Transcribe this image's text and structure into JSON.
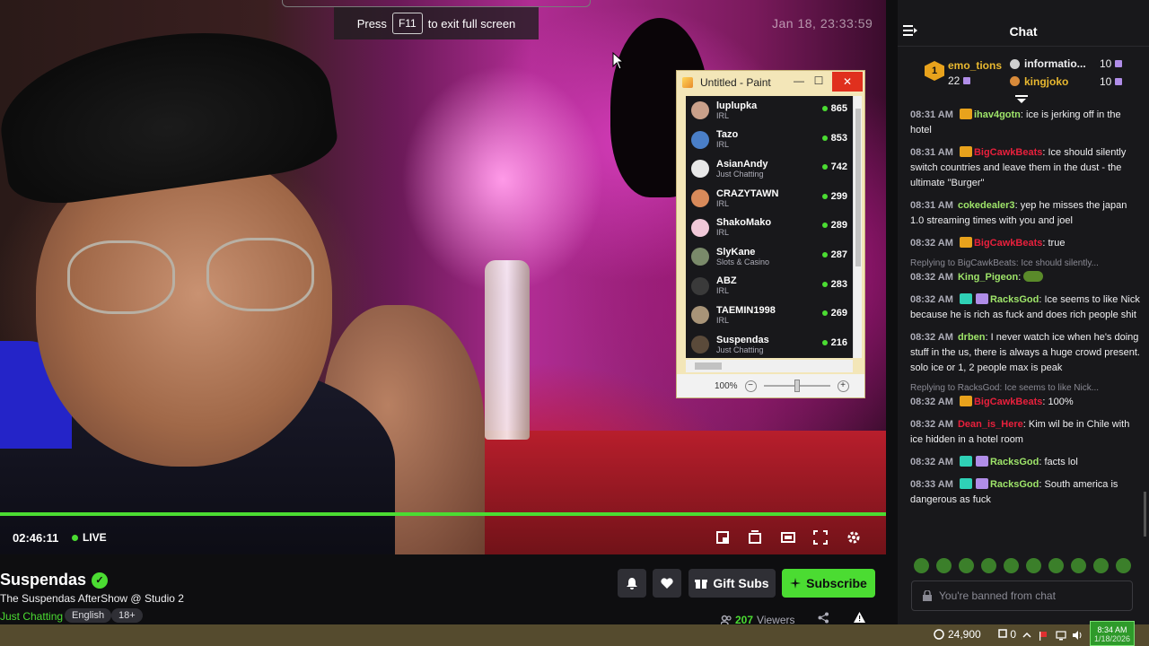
{
  "video": {
    "fullscreen_hint_press": "Press",
    "fullscreen_hint_key": "F11",
    "fullscreen_hint_rest": "to exit full screen",
    "overlay_timestamp": "Jan 18, 23:33:59",
    "elapsed": "02:46:11",
    "live_label": "LIVE"
  },
  "paint": {
    "title": "Untitled - Paint",
    "zoom": "100%",
    "rows": [
      {
        "name": "luplupka",
        "category": "IRL",
        "viewers": "865",
        "avatar": "#c9a08a"
      },
      {
        "name": "Tazo",
        "category": "IRL",
        "viewers": "853",
        "avatar": "#4a7fc8"
      },
      {
        "name": "AsianAndy",
        "category": "Just Chatting",
        "viewers": "742",
        "avatar": "#e8e8e8"
      },
      {
        "name": "CRAZYTAWN",
        "category": "IRL",
        "viewers": "299",
        "avatar": "#d88a5a"
      },
      {
        "name": "ShakoMako",
        "category": "IRL",
        "viewers": "289",
        "avatar": "#f0c8d8"
      },
      {
        "name": "SlyKane",
        "category": "Slots & Casino",
        "viewers": "287",
        "avatar": "#7a8a6a"
      },
      {
        "name": "ABZ",
        "category": "IRL",
        "viewers": "283",
        "avatar": "#3a3a3a"
      },
      {
        "name": "TAEMIN1998",
        "category": "IRL",
        "viewers": "269",
        "avatar": "#a89478"
      },
      {
        "name": "Suspendas",
        "category": "Just Chatting",
        "viewers": "216",
        "avatar": "#5a4a3a"
      }
    ]
  },
  "stream": {
    "streamer": "Suspendas",
    "title": "The Suspendas AfterShow @ Studio 2",
    "category": "Just Chatting",
    "tags": [
      "English",
      "18+"
    ],
    "gift_subs_label": "Gift Subs",
    "subscribe_label": "Subscribe",
    "viewer_count": "207",
    "viewer_label": "Viewers"
  },
  "chat": {
    "header": "Chat",
    "leaderboard": {
      "rank": "1",
      "first_name": "emo_tions",
      "first_value": "22",
      "second_name": "informatio...",
      "second_value": "10",
      "third_name": "kingjoko",
      "third_value": "10"
    },
    "messages": [
      {
        "time": "08:31 AM",
        "user": "ihav4gotn",
        "color": "#9fe56a",
        "text": "ice is jerking off in the hotel",
        "badges": [
          "#e8a21c"
        ]
      },
      {
        "time": "08:31 AM",
        "user": "BigCawkBeats",
        "color": "#e8203c",
        "text": "Ice should silently switch countries and leave them in the dust - the ultimate \"Burger\"",
        "badges": [
          "#e8a21c"
        ]
      },
      {
        "time": "08:31 AM",
        "user": "cokedealer3",
        "color": "#9fe56a",
        "text": "yep he misses the japan 1.0 streaming times with you and joel",
        "badges": []
      },
      {
        "time": "08:32 AM",
        "user": "BigCawkBeats",
        "color": "#e8203c",
        "text": "true",
        "badges": [
          "#e8a21c"
        ]
      },
      {
        "reply": "Replying to BigCawkBeats: Ice should silently...",
        "time": "08:32 AM",
        "user": "King_Pigeon",
        "color": "#9fe56a",
        "text": "",
        "emote": true,
        "badges": []
      },
      {
        "time": "08:32 AM",
        "user": "RacksGod",
        "color": "#9fe56a",
        "text": "Ice seems to like Nick because he is rich as fuck and does rich people shit",
        "badges": [
          "#2fd1b6",
          "#b08de8"
        ]
      },
      {
        "time": "08:32 AM",
        "user": "drben",
        "color": "#9fe56a",
        "text": "I never watch ice when he's doing stuff in the us, there is always a huge crowd present. solo ice or 1, 2 people max is peak",
        "badges": []
      },
      {
        "reply": "Replying to RacksGod: Ice seems to like Nick...",
        "time": "08:32 AM",
        "user": "BigCawkBeats",
        "color": "#e8203c",
        "text": "100%",
        "badges": [
          "#e8a21c"
        ]
      },
      {
        "time": "08:32 AM",
        "user": "Dean_is_Here",
        "color": "#e8203c",
        "text": "Kim wil be in Chile with ice hidden in a hotel room",
        "badges": []
      },
      {
        "time": "08:32 AM",
        "user": "RacksGod",
        "color": "#9fe56a",
        "text": "facts lol",
        "badges": [
          "#2fd1b6",
          "#b08de8"
        ]
      },
      {
        "time": "08:33 AM",
        "user": "RacksGod",
        "color": "#9fe56a",
        "text": "South america is dangerous as fuck",
        "badges": [
          "#2fd1b6",
          "#b08de8"
        ]
      }
    ],
    "input_placeholder": "You're banned from chat"
  },
  "taskbar": {
    "points": "24,900",
    "points2": "0",
    "clock_time": "8:34 AM",
    "clock_date": "1/18/2026"
  }
}
